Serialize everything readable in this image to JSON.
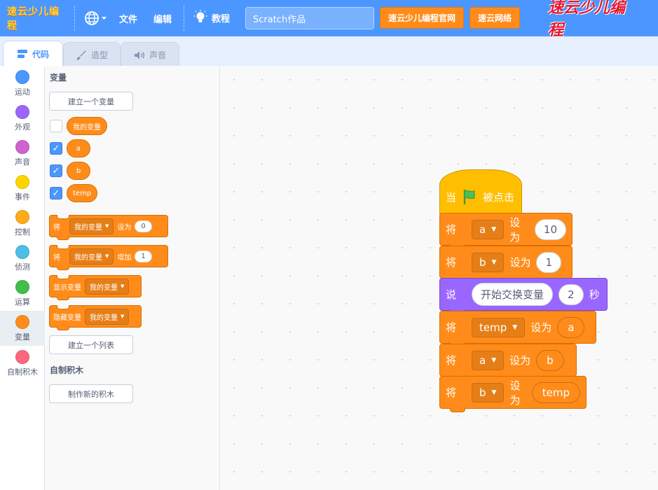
{
  "menubar": {
    "logo": "速云少儿编程",
    "file": "文件",
    "edit": "编辑",
    "tutorial": "教程",
    "project_title": "Scratch作品",
    "btn_official": "速云少儿编程官网",
    "btn_network": "速云网络",
    "brand": "速云少儿编程"
  },
  "tabs": {
    "code": "代码",
    "costumes": "造型",
    "sounds": "声音"
  },
  "categories": [
    {
      "label": "运动",
      "color": "#4c97ff"
    },
    {
      "label": "外观",
      "color": "#9966ff"
    },
    {
      "label": "声音",
      "color": "#cf63cf"
    },
    {
      "label": "事件",
      "color": "#ffd500"
    },
    {
      "label": "控制",
      "color": "#ffab19"
    },
    {
      "label": "侦测",
      "color": "#4cbfe6"
    },
    {
      "label": "运算",
      "color": "#40bf4a"
    },
    {
      "label": "变量",
      "color": "#ff8c1a"
    },
    {
      "label": "自制积木",
      "color": "#ff6680"
    }
  ],
  "palette": {
    "variables_title": "变量",
    "make_variable": "建立一个变量",
    "vars": [
      {
        "name": "我的变量",
        "checked": false
      },
      {
        "name": "a",
        "checked": true
      },
      {
        "name": "b",
        "checked": true
      },
      {
        "name": "temp",
        "checked": true
      }
    ],
    "set_block": {
      "word": "将",
      "var": "我的变量",
      "op": "设为",
      "value": "0"
    },
    "change_block": {
      "word": "将",
      "var": "我的变量",
      "op": "增加",
      "value": "1"
    },
    "show_block": {
      "word": "显示变量",
      "var": "我的变量"
    },
    "hide_block": {
      "word": "隐藏变量",
      "var": "我的变量"
    },
    "make_list": "建立一个列表",
    "my_blocks_title": "自制积木",
    "make_block": "制作新的积木"
  },
  "script": {
    "hat": {
      "when": "当",
      "clicked": "被点击"
    },
    "blocks": [
      {
        "word": "将",
        "var": "a",
        "op": "设为",
        "value": "10",
        "kind": "number"
      },
      {
        "word": "将",
        "var": "b",
        "op": "设为",
        "value": "1",
        "kind": "number"
      },
      {
        "word": "说",
        "text": "开始交换变量",
        "secs": "2",
        "unit": "秒",
        "kind": "say"
      },
      {
        "word": "将",
        "var": "temp",
        "op": "设为",
        "value": "a",
        "kind": "reporter"
      },
      {
        "word": "将",
        "var": "a",
        "op": "设为",
        "value": "b",
        "kind": "reporter"
      },
      {
        "word": "将",
        "var": "b",
        "op": "设为",
        "value": "temp",
        "kind": "reporter"
      }
    ]
  }
}
